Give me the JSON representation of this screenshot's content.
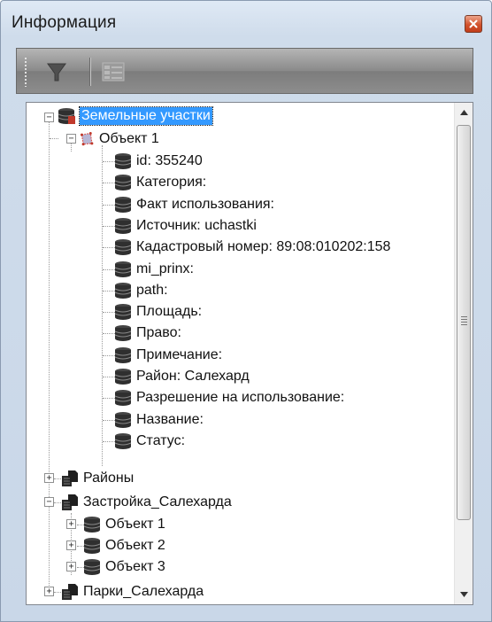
{
  "window": {
    "title": "Информация"
  },
  "toolbar": {
    "filter_icon": "funnel-icon",
    "attributes_icon": "attribute-table-icon"
  },
  "tree": {
    "layers": [
      {
        "label": "Земельные участки",
        "expanded": true,
        "selected": true,
        "icon": "database-layer-icon",
        "objects": [
          {
            "label": "Объект 1",
            "expanded": true,
            "icon": "polygon-object-icon",
            "fields": [
              "id: 355240",
              "Категория:",
              "Факт использования:",
              "Источник: uchastki",
              "Кадастровый номер: 89:08:010202:158",
              "mi_prinx:",
              "path:",
              "Площадь:",
              "Право:",
              "Примечание:",
              "Район: Салехард",
              "Разрешение на использование:",
              "Название:",
              "Статус:"
            ]
          }
        ]
      },
      {
        "label": "Районы",
        "expanded": false,
        "icon": "document-database-icon"
      },
      {
        "label": "Застройка_Салехарда",
        "expanded": true,
        "icon": "document-database-icon",
        "objects": [
          {
            "label": "Объект 1",
            "expanded": false,
            "icon": "database-icon"
          },
          {
            "label": "Объект 2",
            "expanded": false,
            "icon": "database-icon"
          },
          {
            "label": "Объект 3",
            "expanded": false,
            "icon": "database-icon"
          }
        ]
      },
      {
        "label": "Парки_Салехарда",
        "expanded": false,
        "icon": "document-database-icon"
      }
    ]
  },
  "colors": {
    "selection": "#3399ff",
    "close_button": "#d2522c",
    "toolbar": "#8a8a8a"
  }
}
